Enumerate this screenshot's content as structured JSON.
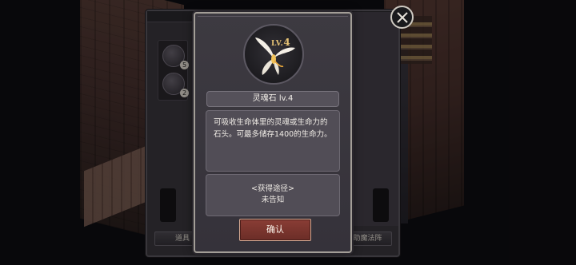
{
  "item": {
    "level": "4",
    "level_prefix": "LV.",
    "name": "灵魂石 lv.4",
    "description": "可吸收生命体里的灵魂或生命力的石头。可最多储存1400的生命力。",
    "source_title": "<获得途径>",
    "source_value": "未告知"
  },
  "buttons": {
    "confirm_label": "确认"
  },
  "inventory": {
    "slot_counts": [
      "5",
      "2"
    ],
    "tabs": [
      "道具",
      "辅助魔法阵"
    ]
  },
  "colors": {
    "confirm_button": "#7a332c",
    "level_gold": "#e8c476",
    "dialog_border": "#a39e97"
  },
  "icons": {
    "close": "close-icon",
    "item": "butterfly-icon"
  }
}
